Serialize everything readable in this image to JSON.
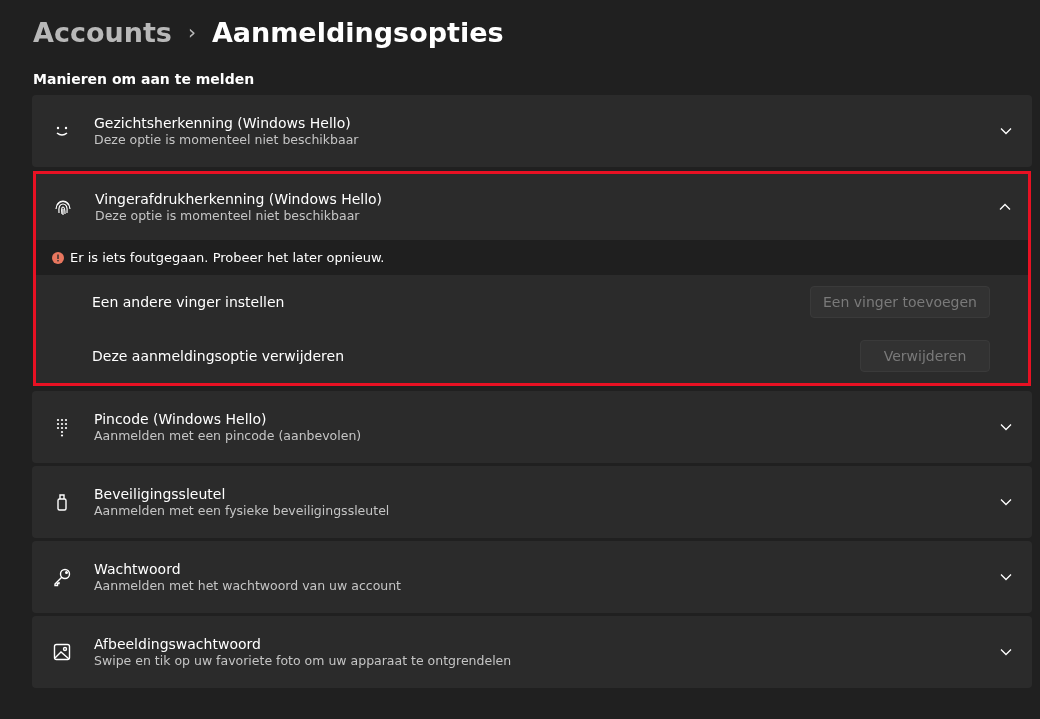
{
  "breadcrumb": {
    "parent": "Accounts",
    "separator": "›",
    "current": "Aanmeldingsopties"
  },
  "section_title": "Manieren om aan te melden",
  "options": [
    {
      "title": "Gezichtsherkenning (Windows Hello)",
      "subtitle": "Deze optie is momenteel niet beschikbaar",
      "expanded": false,
      "highlighted": false
    },
    {
      "title": "Vingerafdrukherkenning (Windows Hello)",
      "subtitle": "Deze optie is momenteel niet beschikbaar",
      "expanded": true,
      "highlighted": true,
      "error": "Er is iets foutgegaan. Probeer het later opnieuw.",
      "settings": [
        {
          "label": "Een andere vinger instellen",
          "button": "Een vinger toevoegen",
          "disabled": true
        },
        {
          "label": "Deze aanmeldingsoptie verwijderen",
          "button": "Verwijderen",
          "disabled": true
        }
      ]
    },
    {
      "title": "Pincode (Windows Hello)",
      "subtitle": "Aanmelden met een pincode (aanbevolen)",
      "expanded": false,
      "highlighted": false
    },
    {
      "title": "Beveiligingssleutel",
      "subtitle": "Aanmelden met een fysieke beveiligingssleutel",
      "expanded": false,
      "highlighted": false
    },
    {
      "title": "Wachtwoord",
      "subtitle": "Aanmelden met het wachtwoord van uw account",
      "expanded": false,
      "highlighted": false
    },
    {
      "title": "Afbeeldingswachtwoord",
      "subtitle": "Swipe en tik op uw favoriete foto om uw apparaat te ontgrendelen",
      "expanded": false,
      "highlighted": false
    }
  ]
}
